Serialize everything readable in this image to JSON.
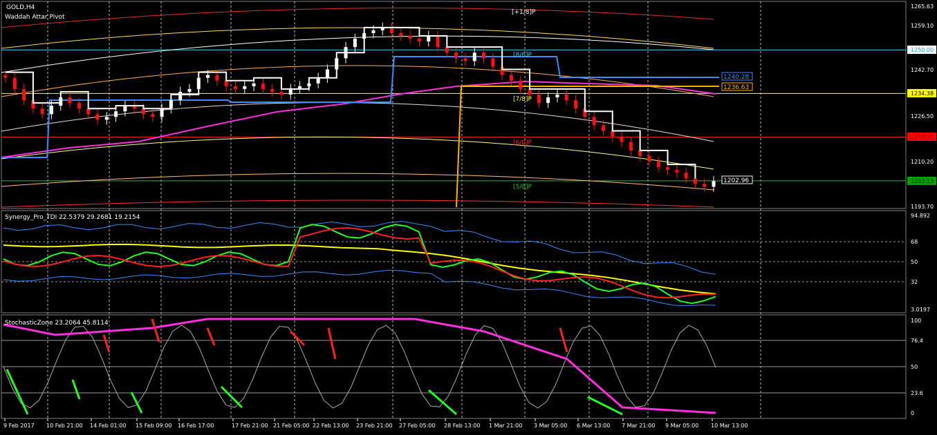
{
  "symbol_label": "GOLD,H4",
  "indicator_label": "Waddah Attar Pivot",
  "panel2_label": "Synergy_Pro_TDI 22.5379 29.2681 19.2154",
  "panel3_label": "StochasticZone 23.2064 45.8114",
  "colors": {
    "bg": "#000000",
    "grid": "#c8c8c8",
    "price_line": "#ffffff",
    "blue_line": "#3b8cff",
    "orange_line": "#ffb000",
    "magenta": "#ff2fe0",
    "bull": "#ffffff",
    "bear": "#ff1010",
    "green": "#22ff22",
    "yellow": "#ffff00",
    "red": "#ff2020"
  },
  "main_price_axis": [
    "1265.63",
    "1259.10",
    "1250.00",
    "1242.70",
    "1234.38",
    "1226.50",
    "1218.75",
    "1210.20",
    "1203.13",
    "1193.70"
  ],
  "price_tags": [
    {
      "text": "1250.00",
      "bg": "#ffffff",
      "fg": "#00a0c0"
    },
    {
      "text": "1234.38",
      "bg": "#ffff00",
      "fg": "#000000"
    },
    {
      "text": "1218.75",
      "bg": "#ff0000",
      "fg": "#800000"
    },
    {
      "text": "1203.13",
      "bg": "#00a000",
      "fg": "#003000"
    }
  ],
  "inline_tags": [
    {
      "text": "1240.28",
      "fg": "#3b8cff"
    },
    {
      "text": "1236.63",
      "fg": "#ffb000"
    },
    {
      "text": "1202.96",
      "fg": "#ffffff"
    }
  ],
  "pivot_labels": [
    {
      "text": "[+1/8]P",
      "color": "#ffffff"
    },
    {
      "text": "[8/8]P",
      "color": "#3bc8ff"
    },
    {
      "text": "[7/8]P",
      "color": "#ffff00"
    },
    {
      "text": "[6/8]P",
      "color": "#ff2020"
    },
    {
      "text": "[5/8]P",
      "color": "#22c022"
    }
  ],
  "panel2_axis": [
    "94.892",
    "68",
    "50",
    "32",
    "3.0197"
  ],
  "panel3_axis": [
    "100",
    "76.4",
    "50",
    "23.6",
    "0"
  ],
  "time_axis": [
    "9 Feb 2017",
    "10 Feb 21:00",
    "14 Feb 01:00",
    "15 Feb 09:00",
    "16 Feb 17:00",
    "17 Feb 21:00",
    "21 Feb 05:00",
    "22 Feb 13:00",
    "23 Feb 21:00",
    "27 Feb 05:00",
    "28 Feb 13:00",
    "1 Mar 21:00",
    "3 Mar 05:00",
    "6 Mar 13:00",
    "7 Mar 21:00",
    "9 Mar 05:00",
    "10 Mar 13:00"
  ],
  "chart_data": {
    "type": "line",
    "series": [
      {
        "name": "GOLD,H4",
        "values": [
          1240,
          1236,
          1232,
          1229,
          1227,
          1230,
          1233,
          1231,
          1229,
          1227,
          1225,
          1226,
          1228,
          1230,
          1229,
          1227,
          1226,
          1229,
          1232,
          1235,
          1236,
          1240,
          1241,
          1239,
          1237,
          1236,
          1237,
          1238,
          1236,
          1235,
          1234,
          1236,
          1237,
          1238,
          1240,
          1243,
          1247,
          1251,
          1254,
          1256,
          1257,
          1258,
          1256,
          1255,
          1254,
          1253,
          1255,
          1251,
          1249,
          1247,
          1246,
          1249,
          1247,
          1244,
          1241,
          1239,
          1236,
          1234,
          1231,
          1233,
          1234,
          1232,
          1229,
          1226,
          1223,
          1221,
          1219,
          1217,
          1214,
          1212,
          1210,
          1208,
          1207,
          1206,
          1204,
          1202,
          1201,
          1203
        ]
      }
    ]
  }
}
